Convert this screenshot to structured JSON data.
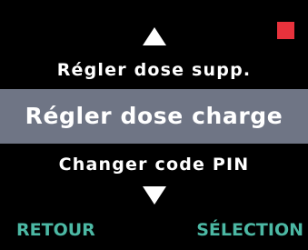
{
  "colors": {
    "background": "#000000",
    "text": "#ffffff",
    "selection_bar": "#6f7585",
    "softkey_text": "#4cb8a4",
    "status_indicator": "#e8323c"
  },
  "icons": {
    "up": "triangle-up-icon",
    "down": "triangle-down-icon",
    "status": "red-square-indicator"
  },
  "menu": {
    "previous": "Régler dose supp.",
    "selected": "Régler dose charge",
    "next": "Changer code PIN"
  },
  "softkeys": {
    "left": "RETOUR",
    "right": "SÉLECTION"
  }
}
